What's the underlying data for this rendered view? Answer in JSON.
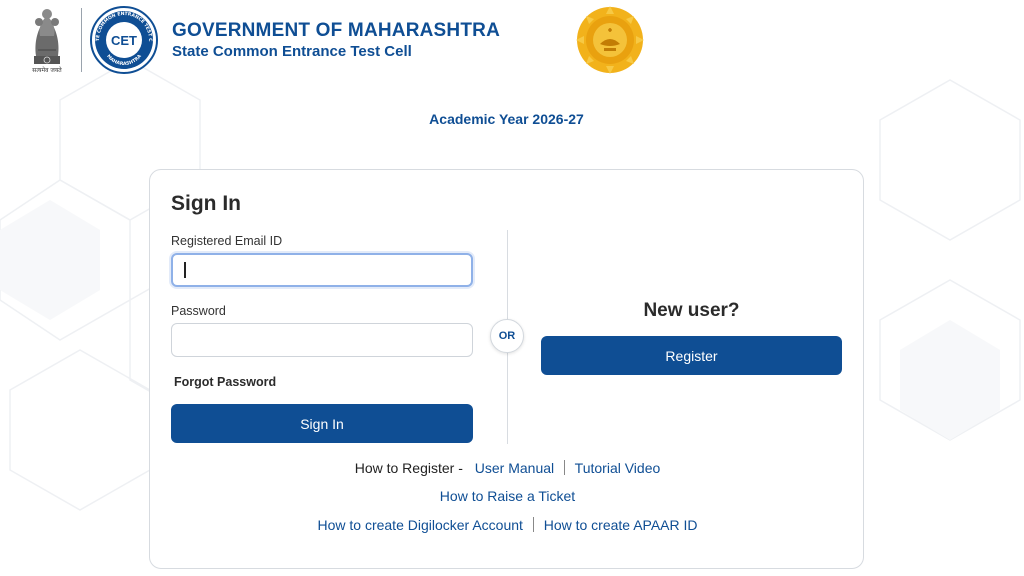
{
  "header": {
    "emblem_caption": "सत्यमेव जयते",
    "cet_logo_text": "CET",
    "cet_ring_top": "STATE COMMON ENTRANCE TEST CELL",
    "cet_ring_bottom": "MAHARASHTRA",
    "title": "GOVERNMENT OF MAHARASHTRA",
    "subtitle": "State Common Entrance Test Cell"
  },
  "academic_year": "Academic Year 2026-27",
  "signin": {
    "title": "Sign In",
    "email_label": "Registered Email ID",
    "email_value": "",
    "email_placeholder": "",
    "password_label": "Password",
    "password_value": "",
    "password_placeholder": "",
    "forgot_password": "Forgot Password",
    "signin_button": "Sign In"
  },
  "or_label": "OR",
  "new_user": {
    "title": "New user?",
    "register_button": "Register"
  },
  "help_links": {
    "how_to_register": "How to Register -",
    "user_manual": "User Manual",
    "tutorial_video": "Tutorial Video",
    "raise_ticket": "How to Raise a Ticket",
    "digilocker": "How to create Digilocker Account",
    "apaar": "How to create APAAR ID"
  },
  "colors": {
    "brand_blue": "#0f4e94",
    "seal_gold": "#f2b21b",
    "focus_border": "#8fb1e8"
  },
  "icons": {
    "emblem": "ashoka-emblem-icon",
    "cet_logo": "cet-logo-icon",
    "seal": "maharashtra-seal-icon"
  }
}
